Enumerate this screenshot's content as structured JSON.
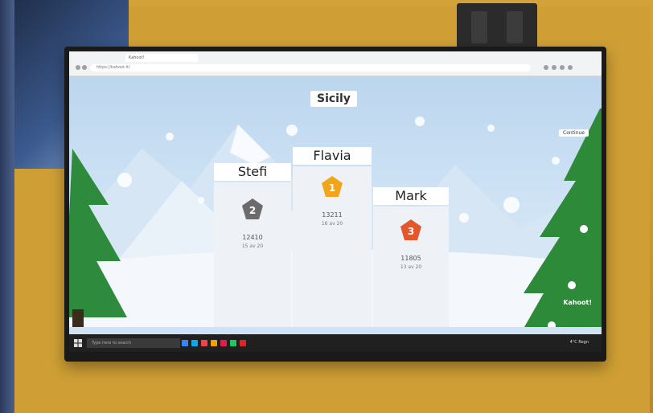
{
  "title": "Sicily",
  "continue_label": "Continue",
  "podium": [
    {
      "rank": 2,
      "name": "Stefi",
      "score": "12410",
      "detail": "15 av 20",
      "color": "#6b6b6b"
    },
    {
      "rank": 1,
      "name": "Flavia",
      "score": "13211",
      "detail": "16 av 20",
      "color": "#f2a51a"
    },
    {
      "rank": 3,
      "name": "Mark",
      "score": "11805",
      "detail": "13 av 20",
      "color": "#e2572b"
    }
  ],
  "logo_text": "Kahoot!",
  "browser": {
    "tab_label": "Kahoot!",
    "address": "https://kahoot.it/"
  },
  "taskbar": {
    "search_placeholder": "Type here to search",
    "tray_text": "4°C Regn"
  }
}
